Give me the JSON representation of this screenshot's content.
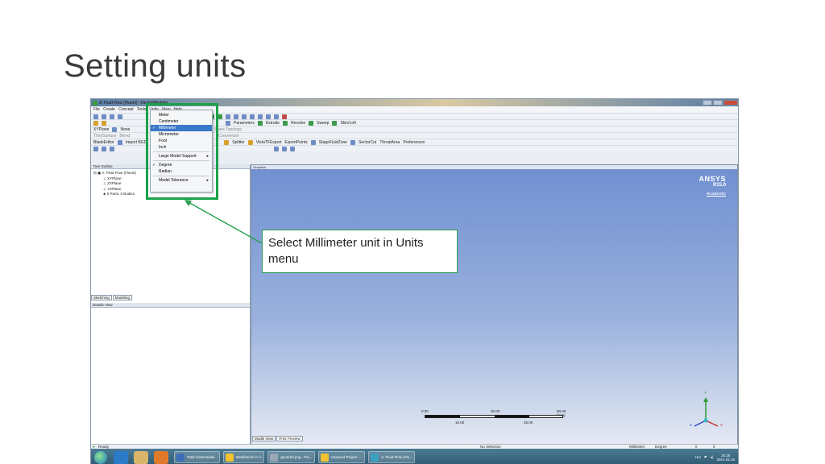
{
  "slide": {
    "title": "Setting units"
  },
  "window": {
    "title": "A: Fluid Flow (Fluent) - DesignModeler",
    "menus": [
      "File",
      "Create",
      "Concept",
      "Tools",
      "Units",
      "View",
      "Help"
    ]
  },
  "toolbars": {
    "row2_items": [
      "Parameters",
      "Extrude",
      "Revolve",
      "Sweep",
      "Skin/Loft"
    ],
    "row3_left": [
      "XYPlane",
      "None"
    ],
    "row3_mid": "Share Topology",
    "row3_right": "Convention",
    "row4_left": [
      "Thin/Surface",
      "Blend"
    ],
    "row5": [
      "BladeEditor",
      "Import BGD",
      "Splitter",
      "VistaTFExport",
      "ExportPoints",
      "StageFluidZone",
      "SectorCut",
      "ThroatArea",
      "Preferences"
    ]
  },
  "tree_outline": {
    "header": "Tree Outline",
    "items": [
      "A: Fluid Flow (Fluent)",
      "XYPlane",
      "ZXPlane",
      "YZPlane",
      "0 Parts, 0 Bodies"
    ]
  },
  "left_tabs": [
    "Sketching",
    "Modeling"
  ],
  "details_view": {
    "header": "Details View"
  },
  "graphics": {
    "header": "Graphics",
    "logo_brand": "ANSYS",
    "logo_version": "R15.0",
    "logo_edition": "Academic",
    "scale_labels_top": [
      "0.00",
      "30.00",
      "60.00 (mm)"
    ],
    "scale_labels_bottom": [
      "15.00",
      "45.00"
    ],
    "axis_labels": [
      "Y",
      "Z",
      "X"
    ],
    "tabs": [
      "Model View",
      "Print Preview"
    ]
  },
  "units_menu": {
    "items": [
      "Meter",
      "Centimeter",
      "Millimeter",
      "Micrometer",
      "Foot",
      "Inch"
    ],
    "selected": "Millimeter",
    "large_model": "Large Model Support",
    "angle_items": [
      "Degree",
      "Radian"
    ],
    "tolerance": "Model Tolerance"
  },
  "status": {
    "ready": "Ready",
    "selection": "No Selection",
    "unit": "Millimeter",
    "angle": "Degree",
    "val1": "0",
    "val2": "0"
  },
  "taskbar": {
    "items": [
      "Total Commande...",
      "Workbench C++",
      "geom2d.png - Pai...",
      "Unsaved Project -...",
      "A: Fluid Flow (Flu..."
    ],
    "lang": "HU",
    "time": "20:25",
    "date": "2014.02.15"
  },
  "callout": {
    "text": "Select Millimeter unit in Units menu"
  },
  "colors": {
    "highlight": "#19a24a",
    "menu_selected": "#3a78c8",
    "graphics_top": "#6f8fd0"
  }
}
